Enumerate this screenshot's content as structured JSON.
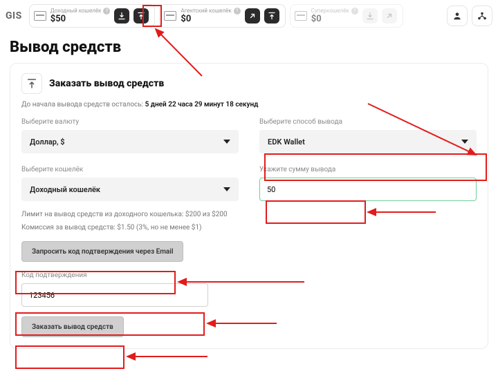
{
  "brand": "GIS",
  "topWallets": [
    {
      "label": "Доходный кошелёк",
      "amount": "$50",
      "disabled": false,
      "buttons": [
        "in",
        "out"
      ]
    },
    {
      "label": "Агентский кошелёк",
      "amount": "$0",
      "disabled": false,
      "buttons": [
        "share",
        "out"
      ]
    },
    {
      "label": "Суперкошелёк",
      "amount": "$0",
      "disabled": true,
      "buttons": [
        "in",
        "share"
      ]
    }
  ],
  "pageTitle": "Вывод средств",
  "card": {
    "title": "Заказать вывод средств",
    "countdownPrefix": "До начала вывода средств осталось:",
    "countdownValue": "5 дней 22 часа 29 минут 18 секунд",
    "currencyLabel": "Выберите валюту",
    "currencyValue": "Доллар, $",
    "methodLabel": "Выберите способ вывода",
    "methodValue": "EDK Wallet",
    "walletLabel": "Выберите кошелёк",
    "walletValue": "Доходный кошелёк",
    "amountLabel": "Укажите сумму вывода",
    "amountValue": "50",
    "limitLine": "Лимит на вывод средств из доходного кошелька: $200 из $200",
    "feeLine": "Комиссия за вывод средств: $1.50 (3%, но не менее $1)",
    "requestCodeBtn": "Запросить код подтверждения через Email",
    "codeLabel": "Код подтверждения",
    "codeValue": "123456",
    "submitBtn": "Заказать вывод средств"
  }
}
